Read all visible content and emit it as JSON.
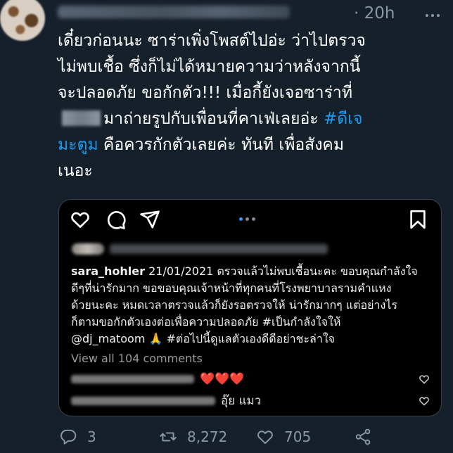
{
  "tweet": {
    "time": "· 20h",
    "lines": [
      {
        "text": "เดี๋ยวก่อนนะ ซาร่าเพิ่งโพสต์ไปอ่ะ ว่าไปตรวจ"
      },
      {
        "text": "ไม่พบเชื้อ ซึ่งก็ไม่ได้หมายความว่าหลังจากนี้"
      },
      {
        "text": "จะปลอดภัย ขอกักตัว!!! เมื่อกี้ยังเจอซาร่าที่"
      },
      {
        "text": "มาถ่ายรูปกับเพื่อนที่คาเฟ่เลยอ่ะ ",
        "hashtag": "#ดีเจ"
      },
      {
        "hashtag": "มะตูม",
        "text": " คือควรกักตัวเลยค่ะ ทันที เพื่อสังคม"
      },
      {
        "text": "เนอะ"
      }
    ],
    "icons": {
      "menu": "more-dots-icon",
      "reply": "reply-icon",
      "retweet": "retweet-icon",
      "like": "heart-icon",
      "share": "share-icon"
    },
    "stats": {
      "replies": "3",
      "retweets": "8,272",
      "likes": "705"
    }
  },
  "instagram": {
    "icons": [
      "heart-icon",
      "comment-icon",
      "send-icon",
      "bookmark-icon"
    ],
    "caption": {
      "username": "sara_hohler",
      "lines": [
        " 21/01/2021 ตรวจแล้วไม่พบเชื้อนะคะ ขอบคุณกำลังใจ",
        "ดีๆที่น่ารักมาก ขอขอบคุณเจ้าหน้าที่ทุกคนที่โรงพยาบาลรามคำแหง",
        "ด้วยนะคะ หมดเวลาตรวจแล้วก็ยังรอตรวจให้ น่ารักมากๆ แต่อย่างไร",
        "ก็ตามขอกักตัวเองต่อเพื่อความปลอดภัย #เป็นกำลังใจให้",
        "@dj_matoom 🙏  #ต่อไปนี้ดูแลตัวเองดีดีอย่าชะล่าใจ"
      ]
    },
    "view_comments": "View all 104 comments",
    "comments": [
      {
        "text": "❤️❤️❤️"
      },
      {
        "text": "อุ๊ย แมว"
      }
    ],
    "colors": {
      "card_bg": "#000000",
      "dot_active": "#3897f0"
    }
  },
  "colors": {
    "background": "#15202b",
    "muted": "#8899a6",
    "hashtag": "#1d9bf0",
    "text": "#ffffff"
  }
}
